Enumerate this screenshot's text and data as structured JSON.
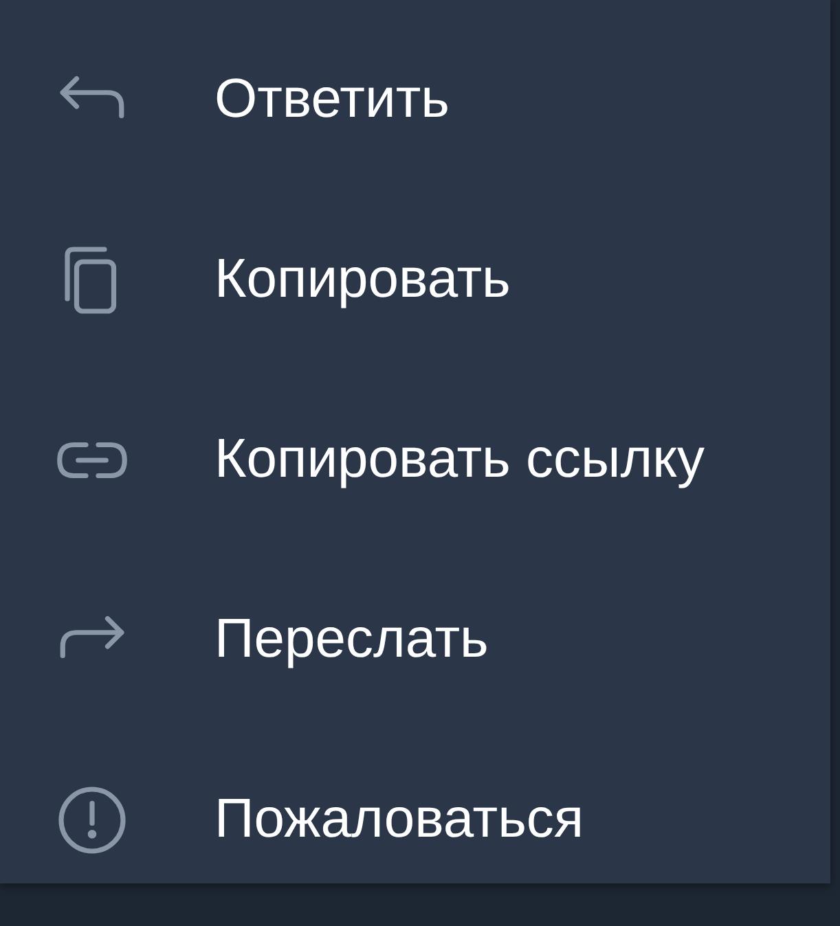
{
  "menu": {
    "items": [
      {
        "kind": "reply",
        "label": "Ответить"
      },
      {
        "kind": "copy",
        "label": "Копировать"
      },
      {
        "kind": "link",
        "label": "Копировать ссылку"
      },
      {
        "kind": "forward",
        "label": "Переслать"
      },
      {
        "kind": "report",
        "label": "Пожаловаться"
      }
    ]
  }
}
